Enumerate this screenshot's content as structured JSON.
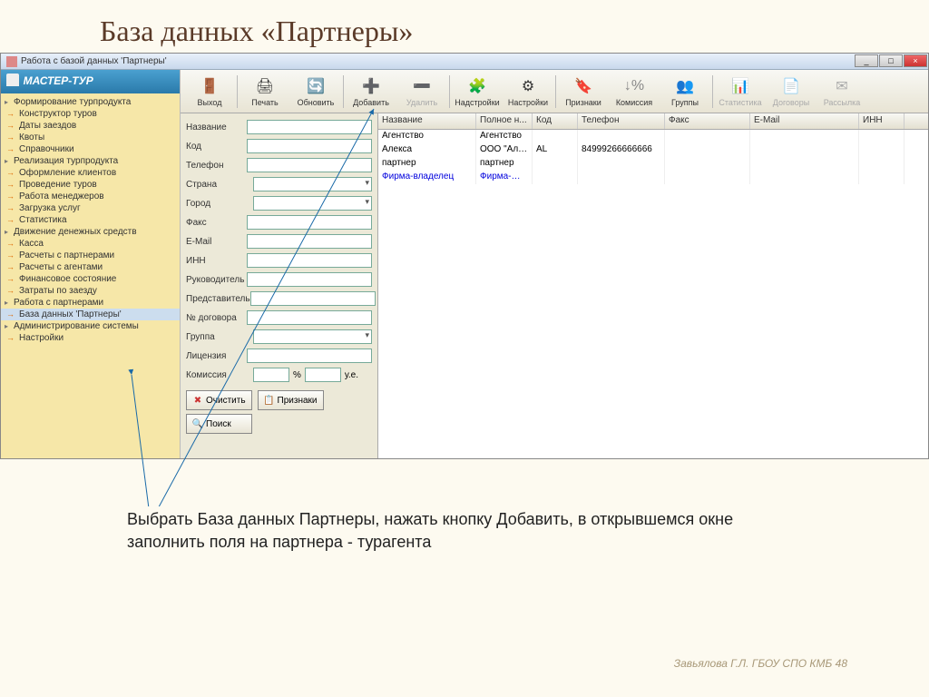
{
  "slide": {
    "title": "База данных «Партнеры»",
    "description": "Выбрать База данных Партнеры, нажать кнопку Добавить, в открывшемся окне заполнить поля на партнера - турагента",
    "footer": "Завьялова Г.Л. ГБОУ СПО КМБ 48"
  },
  "window": {
    "title": "Работа с базой данных 'Партнеры'",
    "logo": "МАСТЕР-ТУР"
  },
  "sidebar": {
    "groups": [
      {
        "label": "Формирование турпродукта",
        "children": [
          "Конструктор туров",
          "Даты заездов",
          "Квоты",
          "Справочники"
        ]
      },
      {
        "label": "Реализация турпродукта",
        "children": [
          "Оформление клиентов",
          "Проведение туров",
          "Работа менеджеров",
          "Загрузка услуг",
          "Статистика"
        ]
      },
      {
        "label": "Движение денежных средств",
        "children": [
          "Касса",
          "Расчеты с партнерами",
          "Расчеты с агентами",
          "Финансовое состояние",
          "Затраты по заезду"
        ]
      },
      {
        "label": "Работа с партнерами",
        "children": [
          "База данных 'Партнеры'"
        ]
      },
      {
        "label": "Администрирование системы",
        "children": [
          "Настройки"
        ]
      }
    ]
  },
  "toolbar": {
    "exit": "Выход",
    "print": "Печать",
    "refresh": "Обновить",
    "add": "Добавить",
    "delete": "Удалить",
    "addons": "Надстройки",
    "settings": "Настройки",
    "attrs": "Признаки",
    "commission": "Комиссия",
    "groups": "Группы",
    "stats": "Статистика",
    "contracts": "Договоры",
    "mailing": "Рассылка"
  },
  "form": {
    "name": "Название",
    "code": "Код",
    "phone": "Телефон",
    "country": "Страна",
    "city": "Город",
    "fax": "Факс",
    "email": "E-Mail",
    "inn": "ИНН",
    "director": "Руководитель",
    "rep": "Представитель",
    "contract": "№ договора",
    "group": "Группа",
    "license": "Лицензия",
    "commission": "Комиссия",
    "pct": "%",
    "ue": "у.е.",
    "clear": "Очистить",
    "search": "Поиск",
    "attrs": "Признаки"
  },
  "grid": {
    "headers": {
      "name": "Название",
      "full": "Полное н...",
      "code": "Код",
      "phone": "Телефон",
      "fax": "Факс",
      "email": "E-Mail",
      "inn": "ИНН"
    },
    "rows": [
      {
        "name": "Агентство",
        "full": "Агентство",
        "code": "",
        "phone": "",
        "fax": "",
        "email": "",
        "inn": "",
        "blue": false
      },
      {
        "name": "Алекса",
        "full": "ООО \"Ал…",
        "code": "AL",
        "phone": "84999266666666",
        "fax": "",
        "email": "",
        "inn": "",
        "blue": false
      },
      {
        "name": "партнер",
        "full": "партнер",
        "code": "",
        "phone": "",
        "fax": "",
        "email": "",
        "inn": "",
        "blue": false
      },
      {
        "name": "Фирма-владелец",
        "full": "Фирма-…",
        "code": "",
        "phone": "",
        "fax": "",
        "email": "",
        "inn": "",
        "blue": true
      }
    ]
  }
}
